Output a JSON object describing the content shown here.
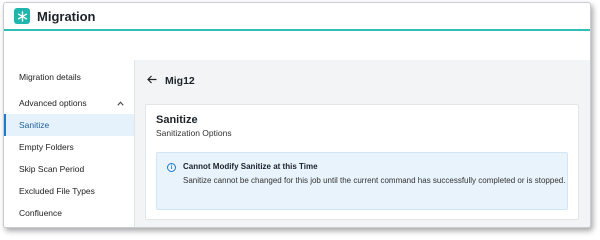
{
  "app": {
    "title": "Migration",
    "brand_color": "#20b5ad"
  },
  "sidebar": {
    "items": [
      {
        "label": "Migration details"
      },
      {
        "label": "Advanced options",
        "caret": "chevron-up"
      },
      {
        "label": "Sanitize",
        "active": true
      },
      {
        "label": "Empty Folders"
      },
      {
        "label": "Skip Scan Period"
      },
      {
        "label": "Excluded File Types"
      },
      {
        "label": "Confluence"
      }
    ]
  },
  "page": {
    "title": "Mig12"
  },
  "card": {
    "title": "Sanitize",
    "subtitle": "Sanitization Options",
    "notice": {
      "title": "Cannot Modify Sanitize at this Time",
      "body": "Sanitize cannot be changed for this job until the current command has successfully completed or is stopped."
    }
  },
  "colors": {
    "accent": "#1f7acb",
    "info_bg": "#e8f3fc"
  }
}
